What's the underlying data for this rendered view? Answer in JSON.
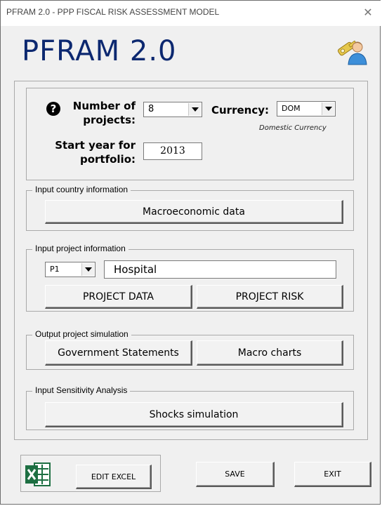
{
  "window": {
    "title": "PFRAM 2.0 - PPP FISCAL RISK ASSESSMENT MODEL",
    "close_glyph": "✕"
  },
  "app": {
    "title": "PFRAM 2.0"
  },
  "setup": {
    "help_glyph": "?",
    "projects_label": "Number of projects:",
    "projects_value": "8",
    "currency_label": "Currency:",
    "currency_value": "DOM",
    "currency_note": "Domestic Currency",
    "start_year_label": "Start year for portfolio:",
    "start_year_value": "2013"
  },
  "country": {
    "legend": "Input country information",
    "macro_button": "Macroeconomic data"
  },
  "project": {
    "legend": "Input project information",
    "project_selector": "P1",
    "project_name": "Hospital",
    "data_button": "PROJECT DATA",
    "risk_button": "PROJECT RISK"
  },
  "output": {
    "legend": "Output project simulation",
    "gov_button": "Government Statements",
    "charts_button": "Macro charts"
  },
  "sensitivity": {
    "legend": "Input Sensitivity Analysis",
    "shocks_button": "Shocks simulation"
  },
  "footer": {
    "edit_excel": "EDIT EXCEL",
    "save": "SAVE",
    "exit": "EXIT"
  },
  "colors": {
    "title": "#0c2870",
    "excel_green": "#1d6f42"
  },
  "icons": [
    "close-icon",
    "user-key-icon",
    "help-icon",
    "excel-icon",
    "dropdown-arrow-icon"
  ]
}
